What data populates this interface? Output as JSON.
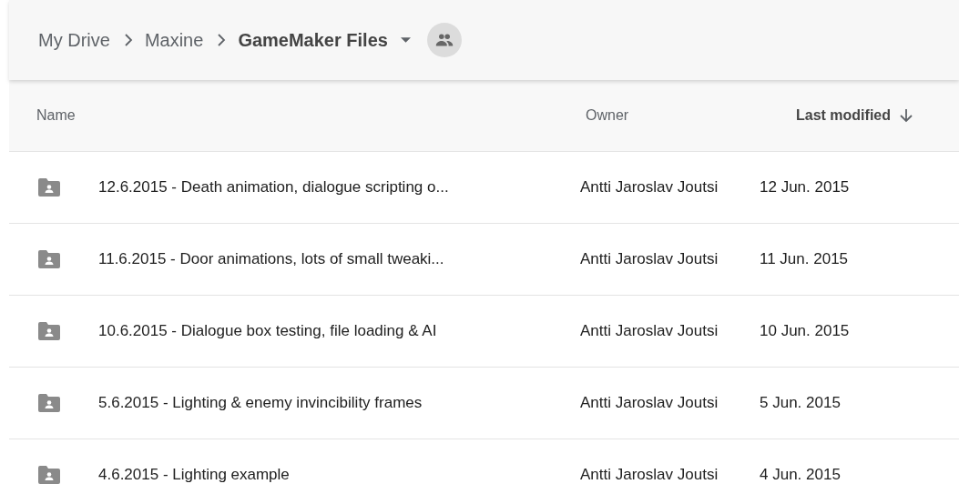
{
  "breadcrumb": [
    {
      "label": "My Drive",
      "current": false
    },
    {
      "label": "Maxine",
      "current": false
    },
    {
      "label": "GameMaker Files",
      "current": true
    }
  ],
  "table": {
    "columns": [
      {
        "label": "Name",
        "sorted": false
      },
      {
        "label": "Owner",
        "sorted": false
      },
      {
        "label": "Last modified",
        "sorted": true
      }
    ],
    "rows": [
      {
        "name": "12.6.2015 - Death animation, dialogue scripting o...",
        "owner": "Antti Jaroslav Joutsi",
        "modified": "12 Jun. 2015"
      },
      {
        "name": "11.6.2015 - Door animations, lots of small tweaki...",
        "owner": "Antti Jaroslav Joutsi",
        "modified": "11 Jun. 2015"
      },
      {
        "name": "10.6.2015 - Dialogue box testing, file loading & AI",
        "owner": "Antti Jaroslav Joutsi",
        "modified": "10 Jun. 2015"
      },
      {
        "name": "5.6.2015 - Lighting & enemy invincibility frames",
        "owner": "Antti Jaroslav Joutsi",
        "modified": "5 Jun. 2015"
      },
      {
        "name": "4.6.2015 - Lighting example",
        "owner": "Antti Jaroslav Joutsi",
        "modified": "4 Jun. 2015"
      }
    ]
  }
}
